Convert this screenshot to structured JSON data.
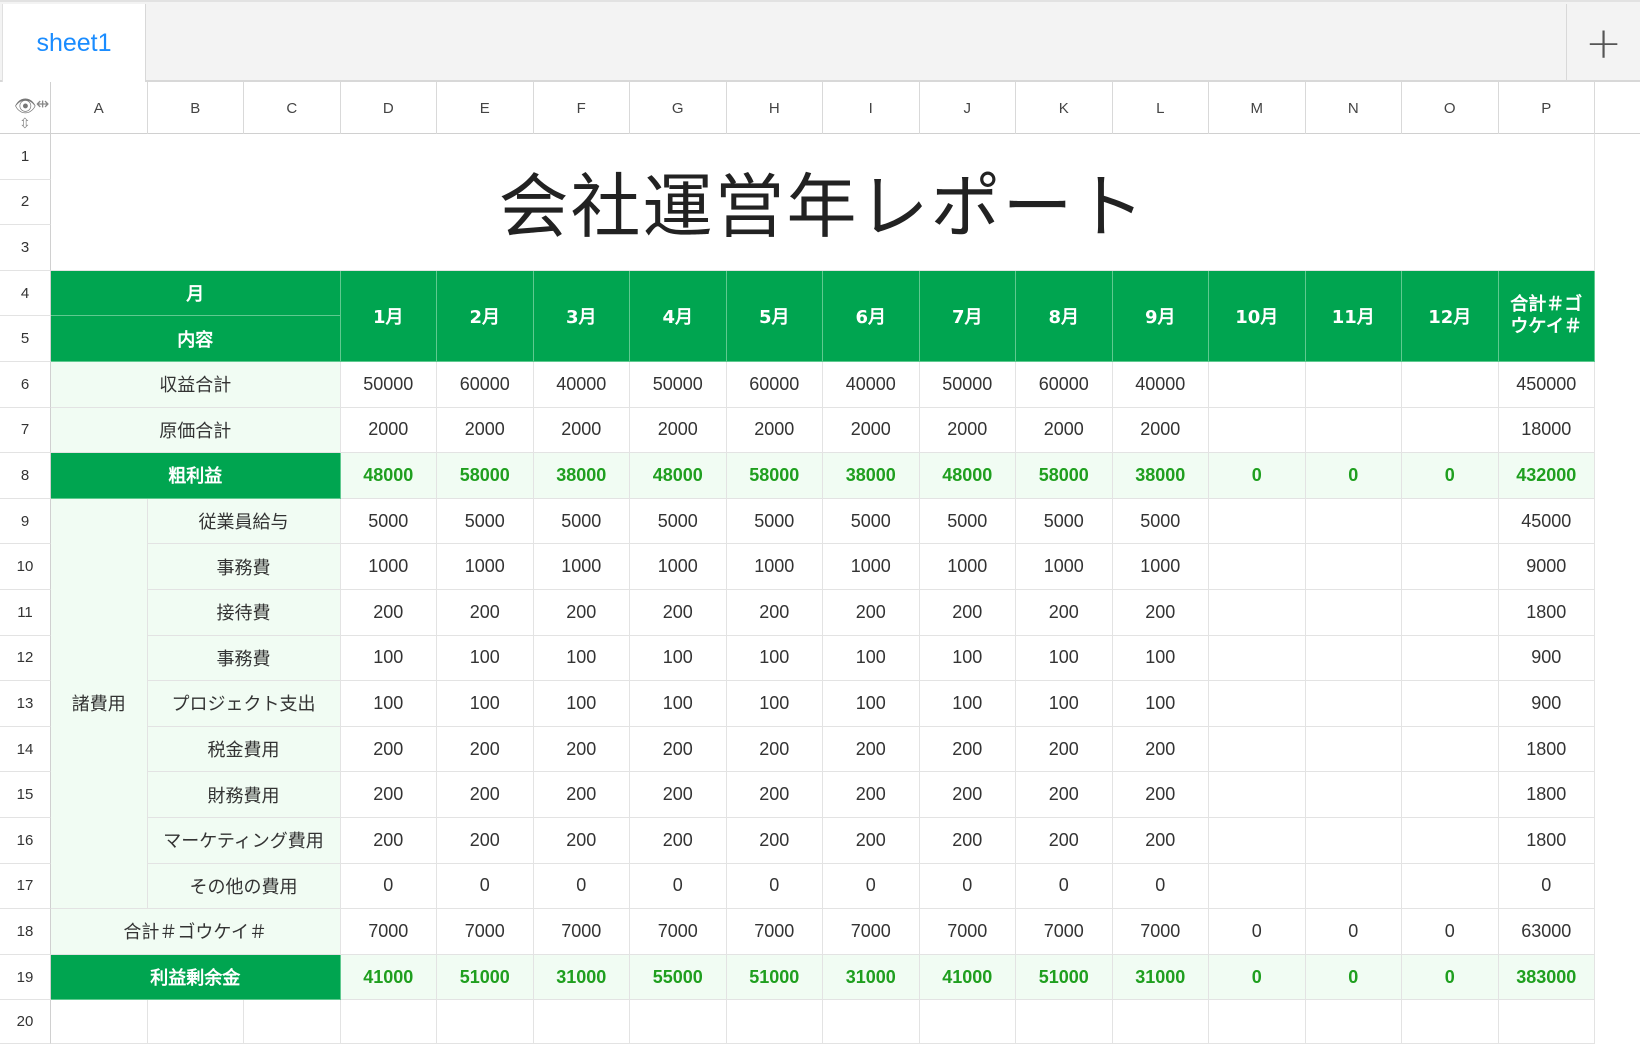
{
  "tabs": {
    "active": "sheet1",
    "add_icon": "plus-icon"
  },
  "columns": [
    "A",
    "B",
    "C",
    "D",
    "E",
    "F",
    "G",
    "H",
    "I",
    "J",
    "K",
    "L",
    "M",
    "N",
    "O",
    "P"
  ],
  "rows": [
    "1",
    "2",
    "3",
    "4",
    "5",
    "6",
    "7",
    "8",
    "9",
    "10",
    "11",
    "12",
    "13",
    "14",
    "15",
    "16",
    "17",
    "18",
    "19",
    "20"
  ],
  "corner": {
    "visibility_icon": "eye-icon",
    "resize_col_icon": "column-resize-icon",
    "resize_row_icon": "row-resize-icon"
  },
  "title": "会社運営年レポート",
  "header": {
    "month_label": "月",
    "content_label": "内容",
    "months": [
      "1月",
      "2月",
      "3月",
      "4月",
      "5月",
      "6月",
      "7月",
      "8月",
      "9月",
      "10月",
      "11月",
      "12月"
    ],
    "total": "合計＃ゴウケイ＃"
  },
  "colors": {
    "header_green": "#00a550",
    "label_bg": "#f1fcf3",
    "profit_text": "#1f9f1f",
    "tab_blue": "#1a8cff"
  },
  "revenue": {
    "label": "収益合計",
    "values": [
      "50000",
      "60000",
      "40000",
      "50000",
      "60000",
      "40000",
      "50000",
      "60000",
      "40000",
      "",
      "",
      ""
    ],
    "total": "450000"
  },
  "cost": {
    "label": "原価合計",
    "values": [
      "2000",
      "2000",
      "2000",
      "2000",
      "2000",
      "2000",
      "2000",
      "2000",
      "2000",
      "",
      "",
      ""
    ],
    "total": "18000"
  },
  "gross_profit": {
    "label": "粗利益",
    "values": [
      "48000",
      "58000",
      "38000",
      "48000",
      "58000",
      "38000",
      "48000",
      "58000",
      "38000",
      "0",
      "0",
      "0"
    ],
    "total": "432000"
  },
  "expenses": {
    "group_label": "諸費用",
    "items": [
      {
        "label": "従業員給与",
        "values": [
          "5000",
          "5000",
          "5000",
          "5000",
          "5000",
          "5000",
          "5000",
          "5000",
          "5000",
          "",
          "",
          ""
        ],
        "total": "45000"
      },
      {
        "label": "事務費",
        "values": [
          "1000",
          "1000",
          "1000",
          "1000",
          "1000",
          "1000",
          "1000",
          "1000",
          "1000",
          "",
          "",
          ""
        ],
        "total": "9000"
      },
      {
        "label": "接待費",
        "values": [
          "200",
          "200",
          "200",
          "200",
          "200",
          "200",
          "200",
          "200",
          "200",
          "",
          "",
          ""
        ],
        "total": "1800"
      },
      {
        "label": "事務費",
        "values": [
          "100",
          "100",
          "100",
          "100",
          "100",
          "100",
          "100",
          "100",
          "100",
          "",
          "",
          ""
        ],
        "total": "900"
      },
      {
        "label": "プロジェクト支出",
        "values": [
          "100",
          "100",
          "100",
          "100",
          "100",
          "100",
          "100",
          "100",
          "100",
          "",
          "",
          ""
        ],
        "total": "900"
      },
      {
        "label": "税金費用",
        "values": [
          "200",
          "200",
          "200",
          "200",
          "200",
          "200",
          "200",
          "200",
          "200",
          "",
          "",
          ""
        ],
        "total": "1800"
      },
      {
        "label": "財務費用",
        "values": [
          "200",
          "200",
          "200",
          "200",
          "200",
          "200",
          "200",
          "200",
          "200",
          "",
          "",
          ""
        ],
        "total": "1800"
      },
      {
        "label": "マーケティング費用",
        "values": [
          "200",
          "200",
          "200",
          "200",
          "200",
          "200",
          "200",
          "200",
          "200",
          "",
          "",
          ""
        ],
        "total": "1800"
      },
      {
        "label": "その他の費用",
        "values": [
          "0",
          "0",
          "0",
          "0",
          "0",
          "0",
          "0",
          "0",
          "0",
          "",
          "",
          ""
        ],
        "total": "0"
      }
    ]
  },
  "expense_total": {
    "label": "合計＃ゴウケイ＃",
    "values": [
      "7000",
      "7000",
      "7000",
      "7000",
      "7000",
      "7000",
      "7000",
      "7000",
      "7000",
      "0",
      "0",
      "0"
    ],
    "total": "63000"
  },
  "net_profit": {
    "label": "利益剰余金",
    "values": [
      "41000",
      "51000",
      "31000",
      "55000",
      "51000",
      "31000",
      "41000",
      "51000",
      "31000",
      "0",
      "0",
      "0"
    ],
    "total": "383000"
  }
}
